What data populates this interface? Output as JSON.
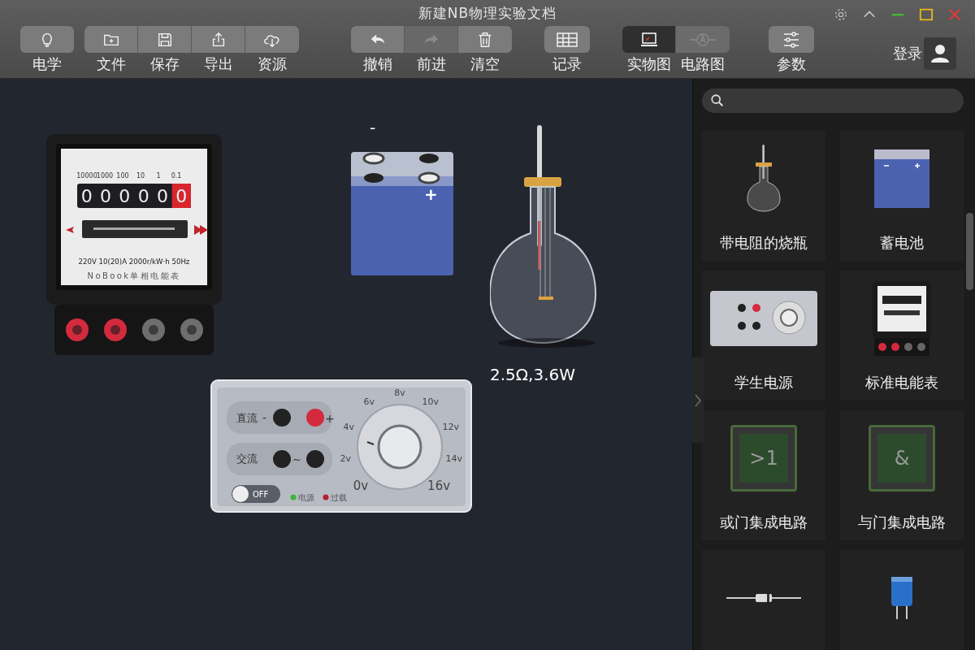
{
  "window": {
    "title": "新建NB物理实验文档"
  },
  "toolbar": {
    "groups": [
      {
        "kind": "buttons",
        "items": [
          {
            "label": "电学",
            "disabled": false
          }
        ]
      },
      {
        "kind": "buttons",
        "items": [
          {
            "label": "文件",
            "disabled": false
          },
          {
            "label": "保存",
            "disabled": false
          },
          {
            "label": "导出",
            "disabled": false
          },
          {
            "label": "资源",
            "disabled": false
          }
        ]
      },
      {
        "kind": "buttons",
        "items": [
          {
            "label": "撤销",
            "disabled": false
          },
          {
            "label": "前进",
            "disabled": true
          },
          {
            "label": "清空",
            "disabled": false
          }
        ]
      },
      {
        "kind": "buttons",
        "items": [
          {
            "label": "记录",
            "disabled": false
          }
        ]
      },
      {
        "kind": "toggle",
        "items": [
          {
            "label": "实物图",
            "selected": true
          },
          {
            "label": "电路图",
            "selected": false
          }
        ]
      },
      {
        "kind": "buttons",
        "items": [
          {
            "label": "参数",
            "disabled": false
          }
        ]
      }
    ]
  },
  "account": {
    "label": "登录"
  },
  "canvas": {
    "meter": {
      "place_labels": [
        "10000",
        "1000",
        "100",
        "10",
        "1",
        "0.1"
      ],
      "digits": [
        {
          "value": "0",
          "highlighted": false
        },
        {
          "value": "0",
          "highlighted": false
        },
        {
          "value": "0",
          "highlighted": false
        },
        {
          "value": "0",
          "highlighted": false
        },
        {
          "value": "0",
          "highlighted": false
        },
        {
          "value": "0",
          "highlighted": true
        }
      ],
      "rating": "220V 10(20)A 2000r/kW·h 50Hz",
      "brand": "NoBook单相电能表",
      "terminals": [
        {
          "color": "#d42a3e"
        },
        {
          "color": "#d42a3e"
        },
        {
          "color": "#6e6e6e"
        },
        {
          "color": "#6e6e6e"
        }
      ]
    },
    "battery": {
      "minus": "-",
      "plus": "+"
    },
    "flask": {
      "label": "2.5Ω,3.6W"
    },
    "power_supply": {
      "dc_label": "直流",
      "dc_minus": "-",
      "dc_plus": "+",
      "ac_label": "交流",
      "ac_sign": "~",
      "scale": [
        "0v",
        "2v",
        "4v",
        "6v",
        "8v",
        "10v",
        "12v",
        "14v",
        "16v"
      ],
      "switch": {
        "label": "OFF",
        "on": false
      },
      "leds": [
        {
          "label": "电源",
          "color": "#3cb43c"
        },
        {
          "label": "过载",
          "color": "#b4202e"
        }
      ]
    }
  },
  "library": {
    "items": [
      {
        "kind": "flask",
        "label": "带电阻的烧瓶"
      },
      {
        "kind": "battery",
        "label": "蓄电池"
      },
      {
        "kind": "power-supply",
        "label": "学生电源"
      },
      {
        "kind": "meter",
        "label": "标准电能表"
      },
      {
        "kind": "chip",
        "label": "或门集成电路",
        "symbol": ">1"
      },
      {
        "kind": "chip",
        "label": "与门集成电路",
        "symbol": "&"
      },
      {
        "kind": "resistor"
      },
      {
        "kind": "capacitor"
      }
    ]
  }
}
